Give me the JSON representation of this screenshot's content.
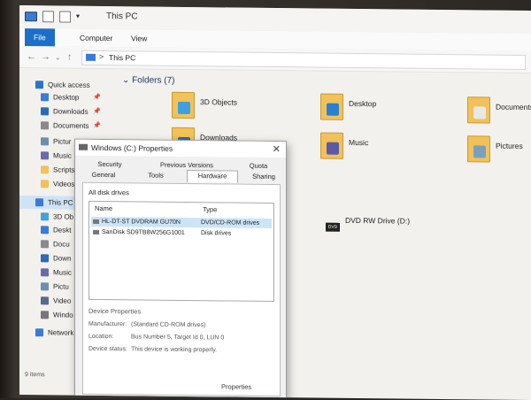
{
  "window": {
    "title": "This PC"
  },
  "ribbon": {
    "tabs": [
      "File",
      "Computer",
      "View"
    ]
  },
  "address": {
    "path": "This PC",
    "separator": ">"
  },
  "nav": {
    "items": [
      {
        "label": "Quick access",
        "icon": "star-icon",
        "pinned": false,
        "selected": false
      },
      {
        "label": "Desktop",
        "icon": "desktop-icon",
        "pinned": true,
        "selected": false
      },
      {
        "label": "Downloads",
        "icon": "download-icon",
        "pinned": true,
        "selected": false
      },
      {
        "label": "Documents",
        "icon": "documents-icon",
        "pinned": true,
        "selected": false
      },
      {
        "label": "Pictur",
        "icon": "pictures-icon",
        "pinned": false,
        "selected": false
      },
      {
        "label": "Music",
        "icon": "music-icon",
        "pinned": false,
        "selected": false
      },
      {
        "label": "Scripts",
        "icon": "folder-icon",
        "pinned": false,
        "selected": false
      },
      {
        "label": "Videos",
        "icon": "folder-icon",
        "pinned": false,
        "selected": false
      },
      {
        "label": "This PC",
        "icon": "computer-icon",
        "pinned": false,
        "selected": true
      },
      {
        "label": "3D Ob",
        "icon": "3d-objects-icon",
        "pinned": false,
        "selected": false
      },
      {
        "label": "Deskt",
        "icon": "desktop-icon",
        "pinned": false,
        "selected": false
      },
      {
        "label": "Docu",
        "icon": "documents-icon",
        "pinned": false,
        "selected": false
      },
      {
        "label": "Down",
        "icon": "download-icon",
        "pinned": false,
        "selected": false
      },
      {
        "label": "Music",
        "icon": "music-icon",
        "pinned": false,
        "selected": false
      },
      {
        "label": "Pictu",
        "icon": "pictures-icon",
        "pinned": false,
        "selected": false
      },
      {
        "label": "Video",
        "icon": "videos-icon",
        "pinned": false,
        "selected": false
      },
      {
        "label": "Windo",
        "icon": "drive-icon",
        "pinned": false,
        "selected": false
      },
      {
        "label": "Network",
        "icon": "network-icon",
        "pinned": false,
        "selected": false
      }
    ]
  },
  "status": {
    "text": "9 items"
  },
  "content": {
    "group_header": "Folders (7)",
    "folders": [
      {
        "label": "3D Objects",
        "icon": "3d-objects-icon"
      },
      {
        "label": "Desktop",
        "icon": "desktop-icon"
      },
      {
        "label": "Documents",
        "icon": "documents-icon"
      },
      {
        "label": "Downloads",
        "icon": "download-icon"
      },
      {
        "label": "Music",
        "icon": "music-icon"
      },
      {
        "label": "Pictures",
        "icon": "pictures-icon"
      }
    ],
    "drive": {
      "label": "DVD RW Drive (D:)",
      "icon_text": "DVD"
    }
  },
  "dialog": {
    "title": "Windows (C:) Properties",
    "close": "✕",
    "tabs_row1": [
      "Security",
      "Previous Versions",
      "Quota"
    ],
    "tabs_row2": [
      "General",
      "Tools",
      "Hardware",
      "Sharing"
    ],
    "active_tab": "Hardware",
    "all_disk_label": "All disk drives",
    "columns": [
      "Name",
      "Type"
    ],
    "rows": [
      {
        "name": "HL-DT-ST DVDRAM GU70N",
        "type": "DVD/CD-ROM drives",
        "selected": true
      },
      {
        "name": "SanDisk SD9TB8W256G1001",
        "type": "Disk drives",
        "selected": false
      }
    ],
    "device_properties": {
      "header": "Device Properties",
      "manufacturer_label": "Manufacturer:",
      "manufacturer": "(Standard CD-ROM drives)",
      "location_label": "Location:",
      "location": "Bus Number 5, Target Id 0, LUN 0",
      "status_label": "Device status:",
      "status": "This device is working properly."
    },
    "properties_button": "Properties"
  },
  "colors": {
    "accent": "#1c6fc8",
    "folder": "#f1c15a",
    "selection": "#cfe3f7"
  }
}
